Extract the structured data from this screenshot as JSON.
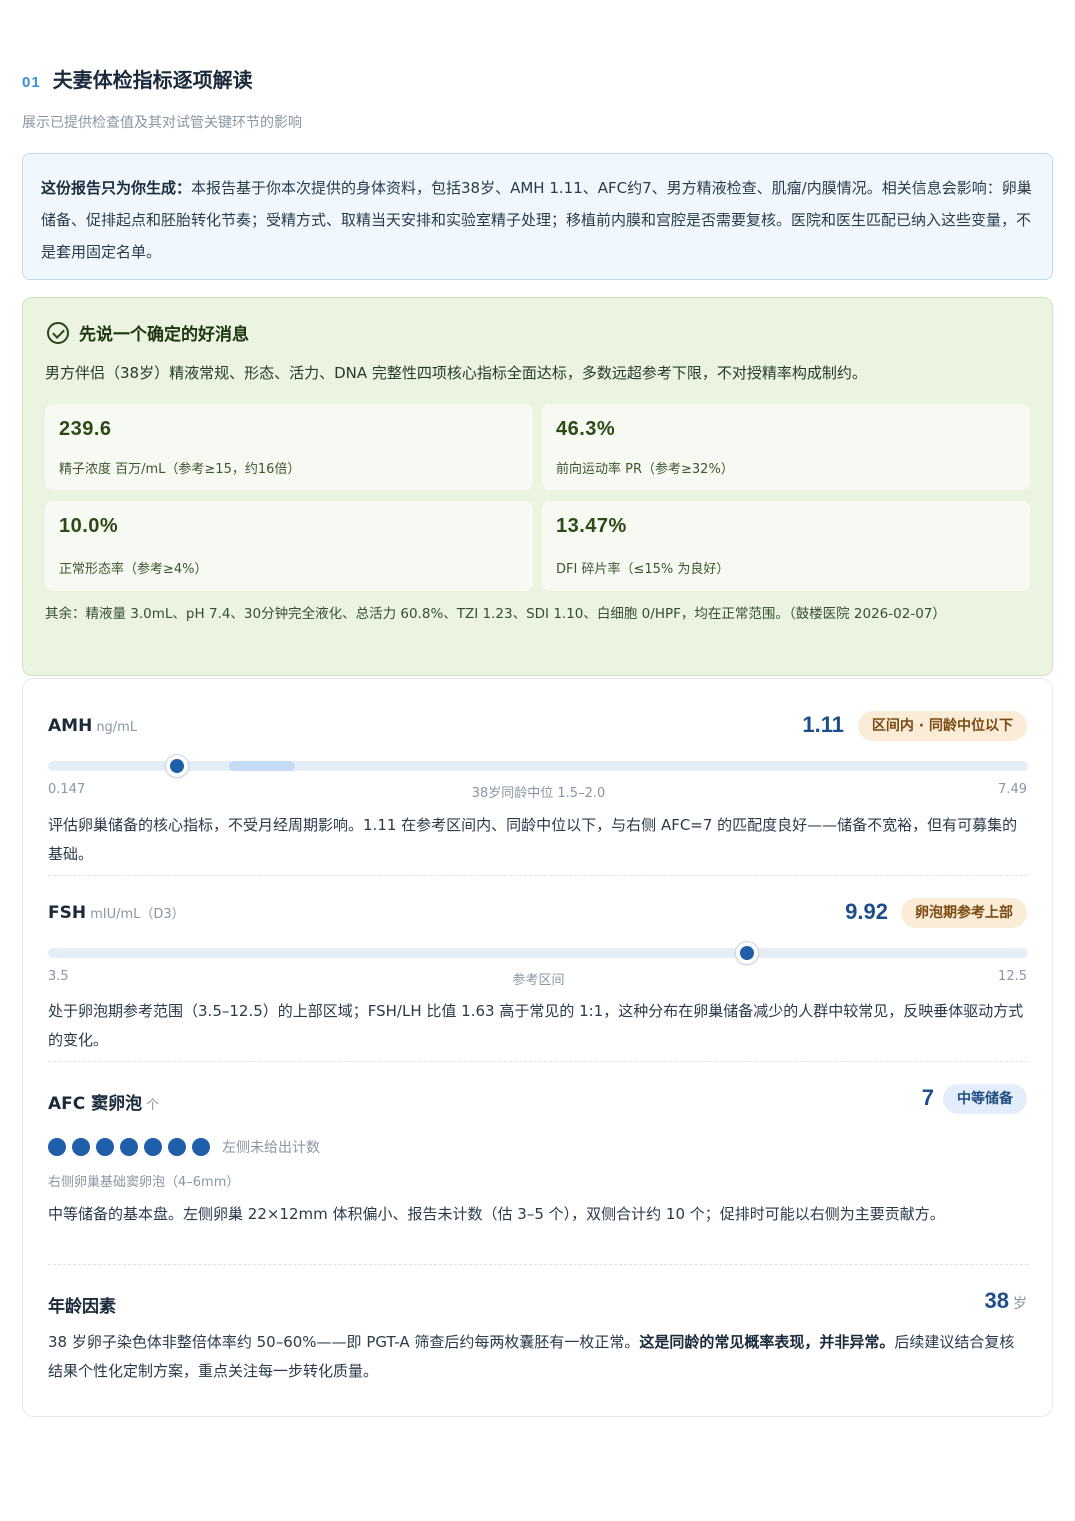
{
  "section": {
    "number": "01",
    "title": "夫妻体检指标逐项解读",
    "subtitle": "展示已提供检查值及其对试管关键环节的影响"
  },
  "intro": {
    "lead": "这份报告只为你生成：",
    "text": "本报告基于你本次提供的身体资料，包括38岁、AMH 1.11、AFC约7、男方精液检查、肌瘤/内膜情况。相关信息会影响：卵巢储备、促排起点和胚胎转化节奏；受精方式、取精当天安排和实验室精子处理；移植前内膜和宫腔是否需要复核。医院和医生匹配已纳入这些变量，不是套用固定名单。"
  },
  "good_news": {
    "title": "先说一个确定的好消息",
    "desc": "男方伴侣（38岁）精液常规、形态、活力、DNA 完整性四项核心指标全面达标，多数远超参考下限，不对授精率构成制约。",
    "stats": [
      {
        "value": "239.6",
        "label": "精子浓度 百万/mL（参考≥15，约16倍）"
      },
      {
        "value": "46.3%",
        "label": "前向运动率 PR（参考≥32%）"
      },
      {
        "value": "10.0%",
        "label": "正常形态率（参考≥4%）"
      },
      {
        "value": "13.47%",
        "label": "DFI 碎片率（≤15% 为良好）"
      }
    ],
    "footnote": "其余：精液量 3.0mL、pH 7.4、30分钟完全液化、总活力 60.8%、TZI 1.23、SDI 1.10、白细胞 0/HPF，均在正常范围。（鼓楼医院 2026-02-07）"
  },
  "metrics": {
    "amh": {
      "name": "AMH",
      "unit": "ng/mL",
      "value": "1.11",
      "badge": "区间内 · 同龄中位以下",
      "min": 0.147,
      "max": 7.49,
      "marker": 1.11,
      "band": [
        1.5,
        2.0
      ],
      "tick_min": "0.147",
      "tick_mid": "38岁同龄中位 1.5–2.0",
      "tick_max": "7.49",
      "desc": "评估卵巢储备的核心指标，不受月经周期影响。1.11 在参考区间内、同龄中位以下，与右侧 AFC=7 的匹配度良好——储备不宽裕，但有可募集的基础。"
    },
    "fsh": {
      "name": "FSH",
      "unit": "mIU/mL（D3）",
      "value": "9.92",
      "badge": "卵泡期参考上部",
      "min": 3.5,
      "max": 12.5,
      "marker": 9.92,
      "tick_min": "3.5",
      "tick_mid": "参考区间",
      "tick_max": "12.5",
      "desc": "处于卵泡期参考范围（3.5–12.5）的上部区域；FSH/LH 比值 1.63 高于常见的 1:1，这种分布在卵巢储备减少的人群中较常见，反映垂体驱动方式的变化。"
    },
    "afc": {
      "name": "AFC 窦卵泡",
      "unit": "个",
      "value": "7",
      "badge": "中等储备",
      "dot_count": 7,
      "dots_note": "左侧未给出计数",
      "sub": "右侧卵巢基础窦卵泡（4–6mm）",
      "desc": "中等储备的基本盘。左侧卵巢 22×12mm 体积偏小、报告未计数（估 3–5 个），双侧合计约 10 个；促排时可能以右侧为主要贡献方。"
    },
    "age": {
      "name": "年龄因素",
      "value": "38",
      "unit": "岁",
      "desc_a": "38 岁卵子染色体非整倍体率约 50–60%——即 PGT-A 筛查后约每两枚囊胚有一枚正常。",
      "desc_b": "这是同龄的常见概率表现，并非异常。",
      "desc_c": "后续建议结合复核结果个性化定制方案，重点关注每一步转化质量。"
    }
  }
}
